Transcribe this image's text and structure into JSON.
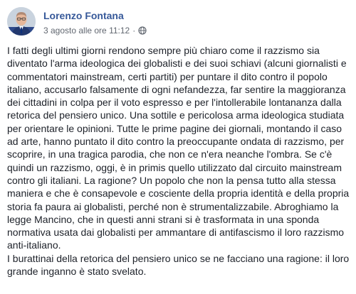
{
  "post": {
    "author": "Lorenzo Fontana",
    "timestamp": "3 agosto alle ore 11:12",
    "separator": "·",
    "privacy_icon": "globe-icon",
    "paragraphs": [
      "I fatti degli ultimi giorni rendono sempre più chiaro come il razzismo sia diventato l'arma ideologica dei globalisti e dei suoi schiavi (alcuni giornalisti e commentatori mainstream, certi partiti) per puntare il dito contro il popolo italiano, accusarlo falsamente di ogni nefandezza, far sentire la maggioranza dei cittadini in colpa per il voto espresso e per l'intollerabile lontananza dalla retorica del pensiero unico. Una sottile e pericolosa arma ideologica studiata per orientare le opinioni. Tutte le prime pagine dei giornali, montando il caso ad arte, hanno puntato il dito contro la preoccupante ondata di razzismo, per scoprire, in una tragica parodia, che non ce n'era neanche l'ombra. Se c'è quindi un razzismo, oggi, è in primis quello utilizzato dal circuito mainstream contro gli italiani. La ragione? Un popolo che non la pensa tutto alla stessa maniera e che è consapevole e cosciente della propria identità e della propria storia fa paura ai globalisti, perché non è strumentalizzabile. Abroghiamo la legge Mancino, che in questi anni strani si è trasformata in una sponda normativa usata dai globalisti per ammantare di antifascismo il loro razzismo anti-italiano.",
      "I burattinai della retorica del pensiero unico se ne facciano una ragione: il loro grande inganno è stato svelato."
    ]
  },
  "colors": {
    "author": "#365899",
    "meta": "#616770",
    "text": "#1d2129"
  }
}
